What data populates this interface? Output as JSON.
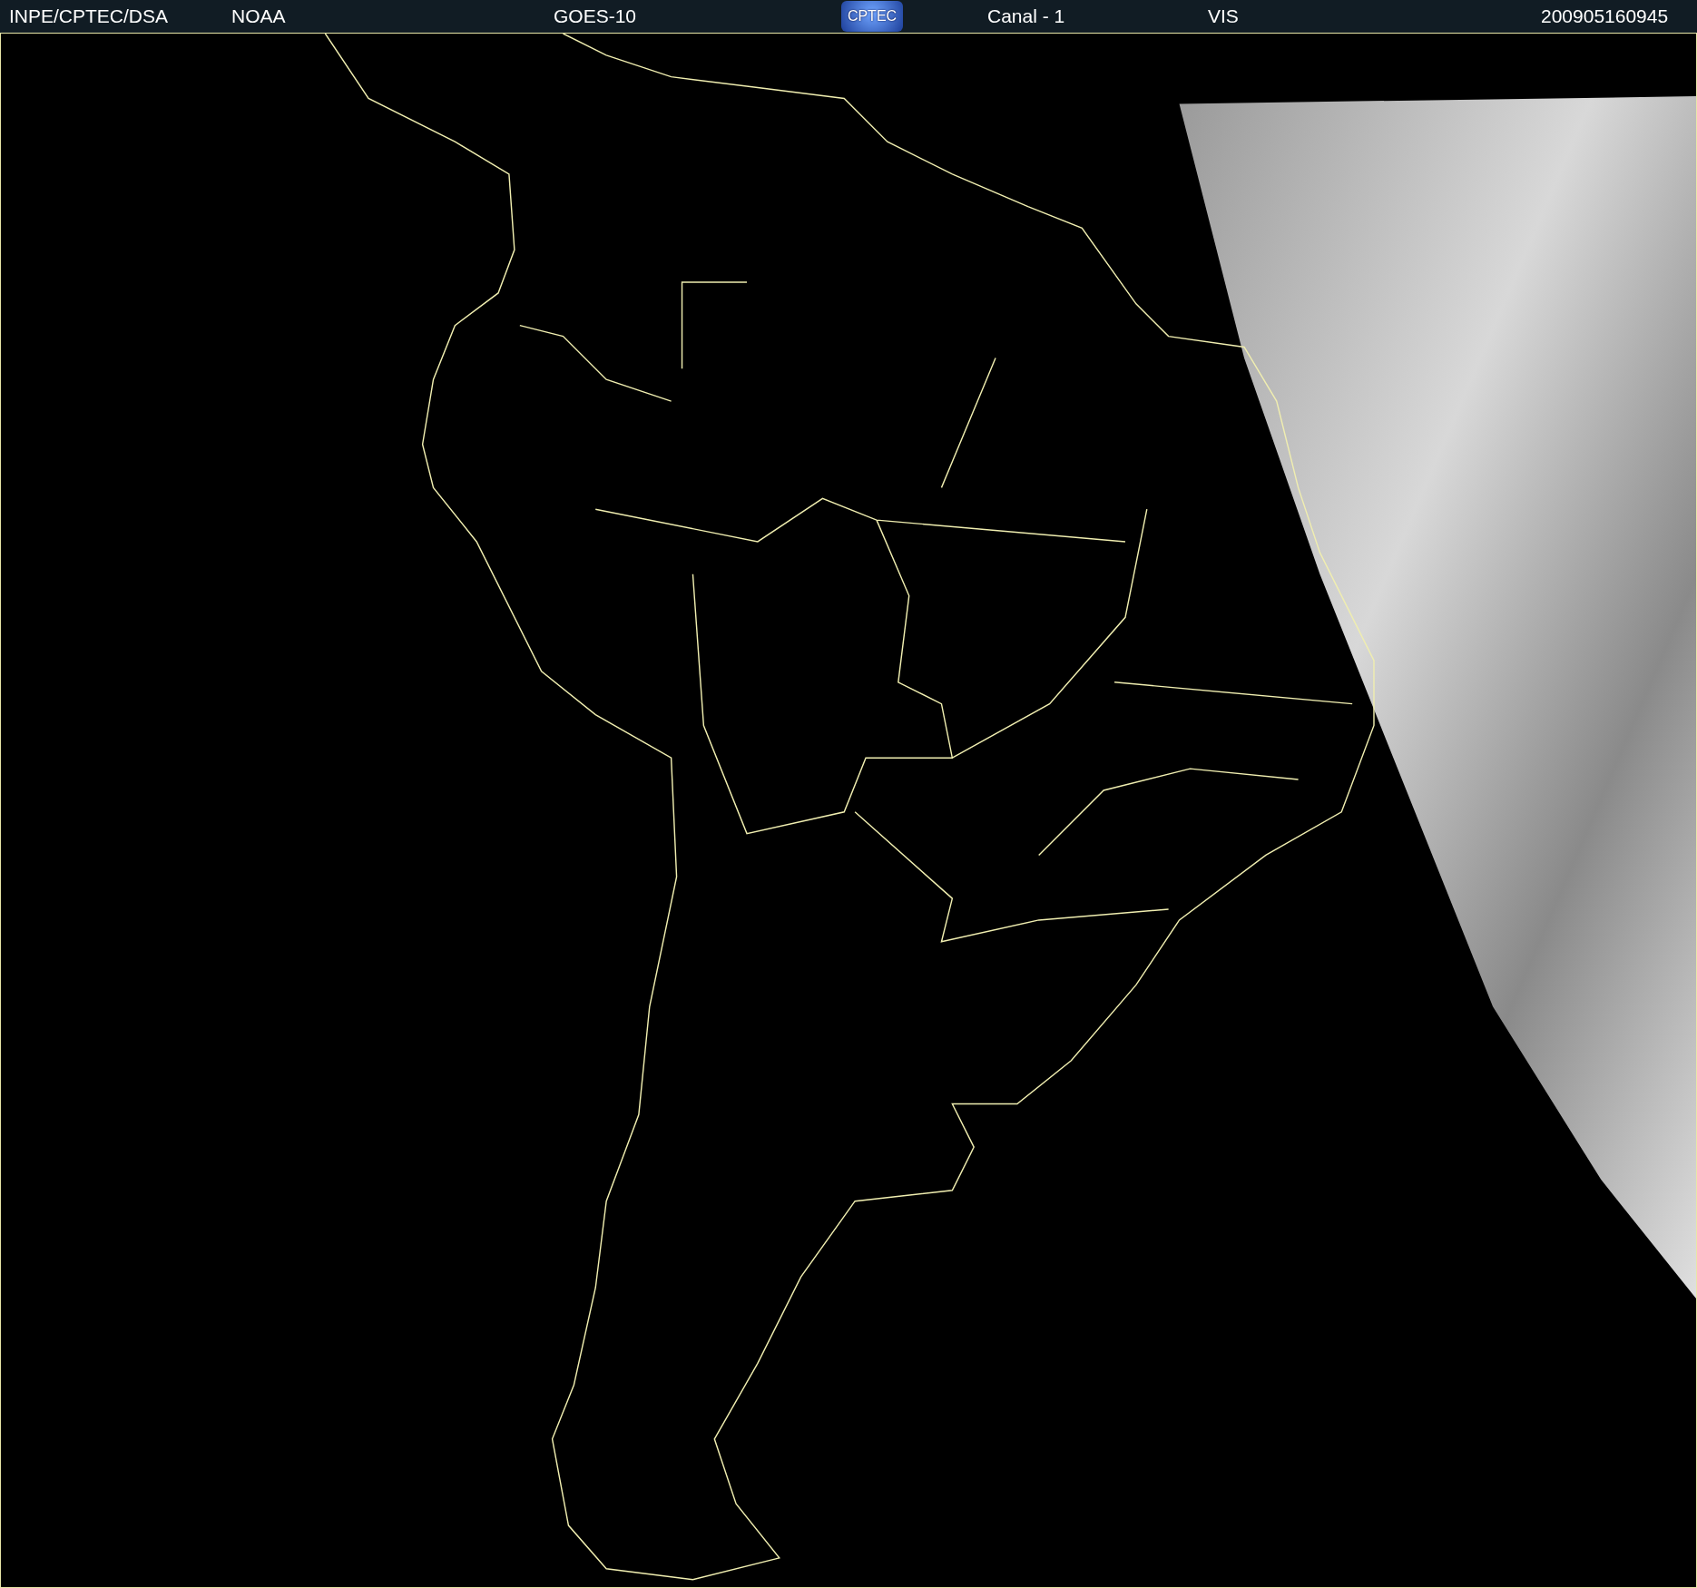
{
  "header": {
    "items": [
      "INPE/CPTEC/DSA",
      "NOAA",
      "GOES-10"
    ],
    "logo": "CPTEC",
    "items_after_logo": [
      "Canal - 1",
      "VIS"
    ],
    "timestamp": "200905160945"
  }
}
